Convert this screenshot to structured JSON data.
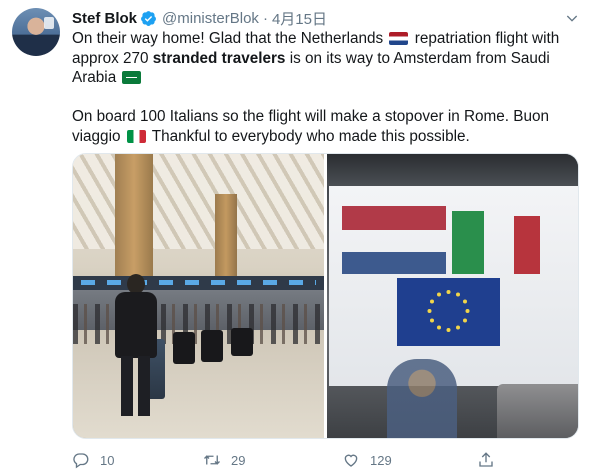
{
  "tweet": {
    "author_name": "Stef Blok",
    "handle": "@ministerBlok",
    "separator": "·",
    "date": "4月15日",
    "text": {
      "p1_a": "On their way home! Glad that the Netherlands",
      "p1_b": "repatriation flight with approx 270",
      "p1_bold": "stranded travelers",
      "p1_c": "is on its way to Amsterdam from Saudi Arabia",
      "p2_a": "On board 100 Italians so the flight will make a stopover in Rome. Buon viaggio",
      "p2_b": "Thankful to everybody who made this possible."
    },
    "flags": [
      "netherlands-flag",
      "saudi-arabia-flag",
      "italy-flag"
    ],
    "media": [
      {
        "name": "airport-check-in-hall-photo"
      },
      {
        "name": "window-flags-photo"
      }
    ]
  },
  "actions": {
    "reply_count": "10",
    "retweet_count": "29",
    "like_count": "129"
  },
  "colors": {
    "text": "#14171a",
    "muted": "#657786",
    "verified": "#1da1f2"
  }
}
